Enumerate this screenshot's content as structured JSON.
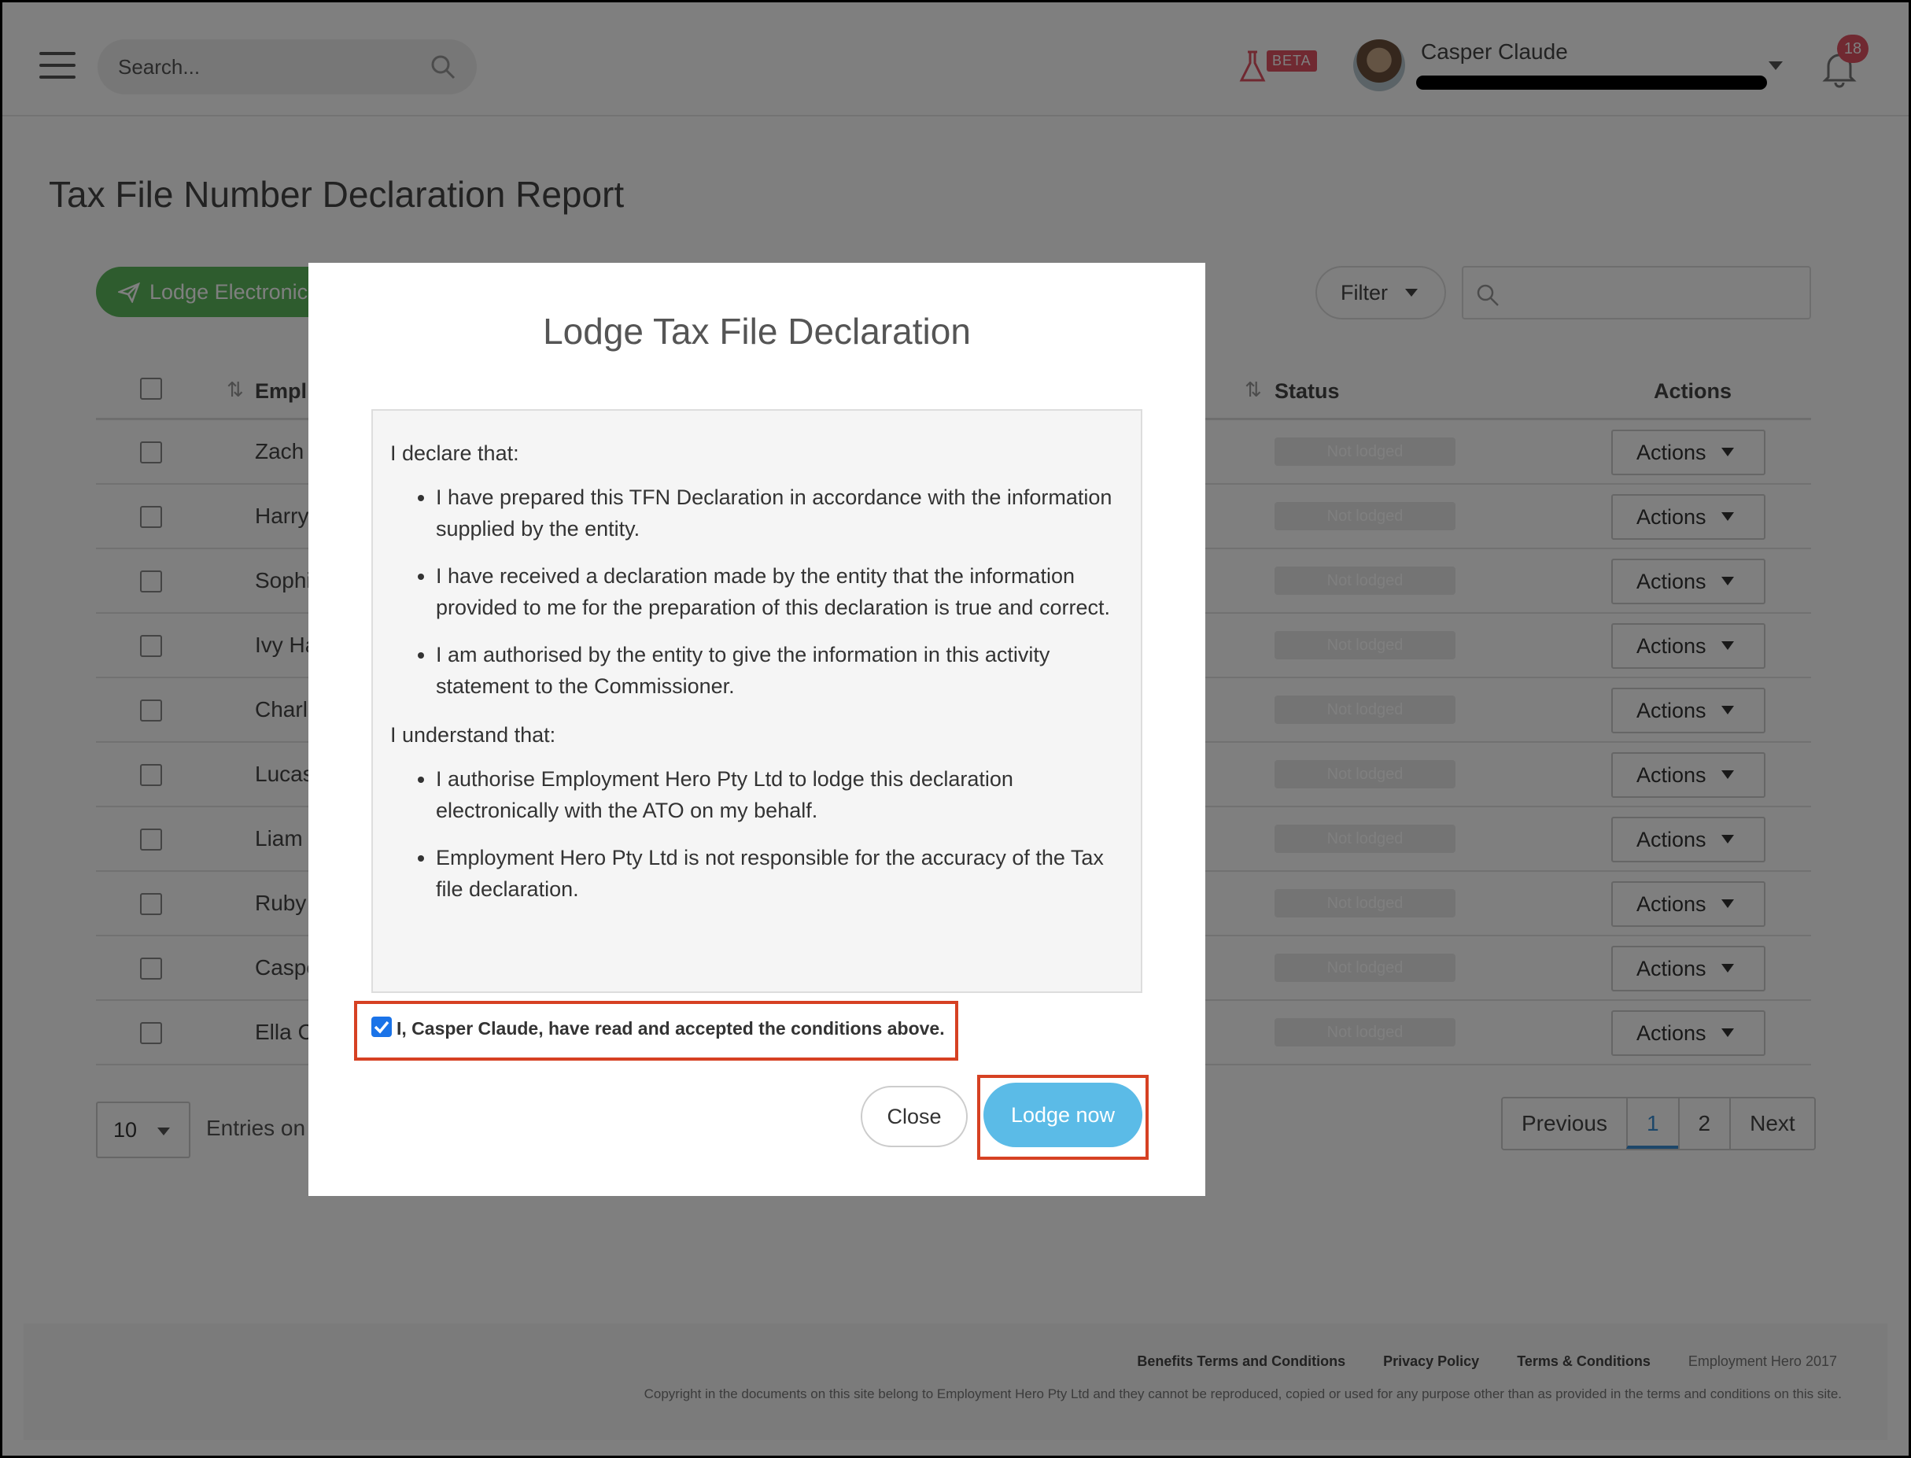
{
  "header": {
    "search_placeholder": "Search...",
    "beta_label": "BETA",
    "user_name": "Casper Claude",
    "notification_count": "18"
  },
  "page": {
    "title": "Tax File Number Declaration Report",
    "lodge_button": "Lodge Electronic",
    "filter_label": "Filter",
    "columns": {
      "employee": "Empl",
      "status": "Status",
      "actions": "Actions"
    },
    "rows": [
      {
        "name": "Zach",
        "status": "Not lodged",
        "action": "Actions"
      },
      {
        "name": "Harry",
        "status": "Not lodged",
        "action": "Actions"
      },
      {
        "name": "Sophi",
        "status": "Not lodged",
        "action": "Actions"
      },
      {
        "name": "Ivy Ha",
        "status": "Not lodged",
        "action": "Actions"
      },
      {
        "name": "Charl",
        "status": "Not lodged",
        "action": "Actions"
      },
      {
        "name": "Lucas",
        "status": "Not lodged",
        "action": "Actions"
      },
      {
        "name": "Liam",
        "status": "Not lodged",
        "action": "Actions"
      },
      {
        "name": "Ruby",
        "status": "Not lodged",
        "action": "Actions"
      },
      {
        "name": "Caspe",
        "status": "Not lodged",
        "action": "Actions"
      },
      {
        "name": "Ella C",
        "status": "Not lodged",
        "action": "Actions"
      }
    ],
    "entries_value": "10",
    "entries_text": "Entries on",
    "pagination": {
      "previous": "Previous",
      "page1": "1",
      "page2": "2",
      "next": "Next"
    }
  },
  "footer": {
    "links": [
      "Benefits Terms and Conditions",
      "Privacy Policy",
      "Terms & Conditions"
    ],
    "brand": "Employment Hero 2017",
    "copyright": "Copyright in the documents on this site belong to Employment Hero Pty Ltd and they cannot be reproduced, copied or used for any purpose other than as provided in the terms and conditions on this site."
  },
  "modal": {
    "title": "Lodge Tax File Declaration",
    "declare_heading": "I declare that:",
    "declare_items": [
      "I have prepared this TFN Declaration in accordance with the information supplied by the entity.",
      "I have received a declaration made by the entity that the information provided to me for the preparation of this declaration is true and correct.",
      "I am authorised by the entity to give the information in this activity statement to the Commissioner."
    ],
    "understand_heading": "I understand that:",
    "understand_items": [
      "I authorise Employment Hero Pty Ltd to lodge this declaration electronically with the ATO on my behalf.",
      "Employment Hero Pty Ltd is not responsible for the accuracy of the Tax file declaration."
    ],
    "accept_label": "I, Casper Claude, have read and accepted the conditions above.",
    "accept_checked": true,
    "close_label": "Close",
    "lodge_label": "Lodge now"
  },
  "colors": {
    "accent": "#5bbbe7",
    "highlight": "#d64123",
    "success": "#5cb85c",
    "badge": "#e05262"
  }
}
